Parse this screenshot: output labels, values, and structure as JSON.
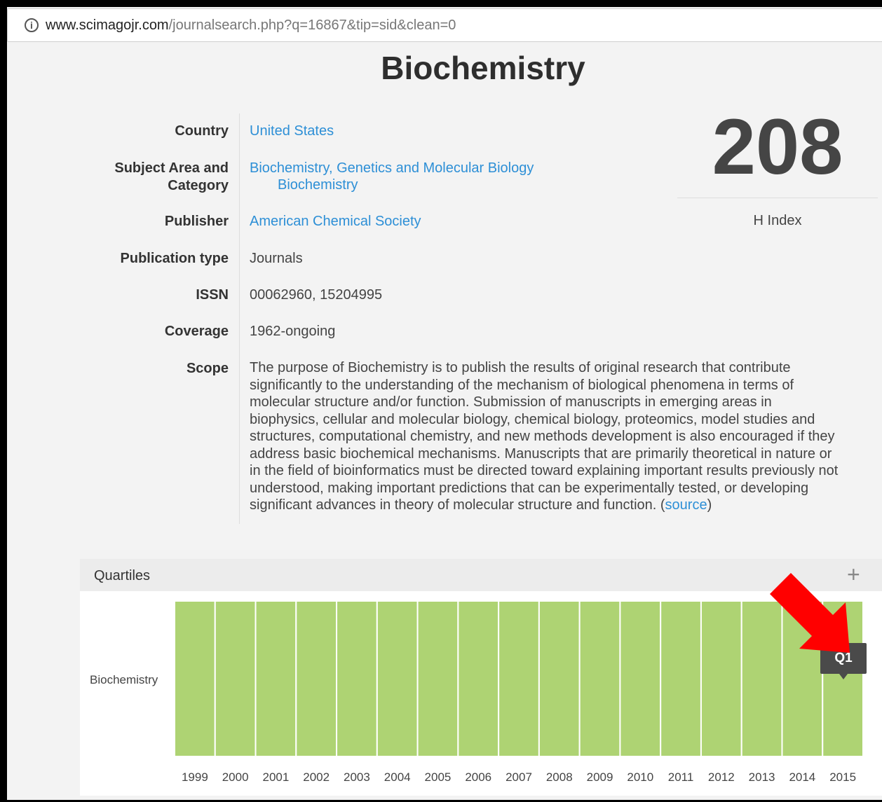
{
  "browser": {
    "url_host": "www.scimagojr.com",
    "url_path": "/journalsearch.php?q=16867&tip=sid&clean=0"
  },
  "journal": {
    "title": "Biochemistry",
    "fields": {
      "country_label": "Country",
      "country_value": "United States",
      "subject_label_1": "Subject Area and",
      "subject_label_2": "Category",
      "subject_area": "Biochemistry, Genetics and Molecular Biology",
      "subject_category": "Biochemistry",
      "publisher_label": "Publisher",
      "publisher_value": "American Chemical Society",
      "pubtype_label": "Publication type",
      "pubtype_value": "Journals",
      "issn_label": "ISSN",
      "issn_value": "00062960, 15204995",
      "coverage_label": "Coverage",
      "coverage_value": "1962-ongoing",
      "scope_label": "Scope",
      "scope_lines": [
        "The purpose of Biochemistry is to publish the results of original research that contribute",
        "significantly to the understanding of the mechanism of biological phenomena in terms of",
        "molecular structure and/or function. Submission of manuscripts in emerging areas in",
        "biophysics, cellular and molecular biology, chemical biology, proteomics, model studies and",
        "structures, computational chemistry, and new methods development is also encouraged if they",
        "address basic biochemical mechanisms. Manuscripts that are primarily theoretical in nature or",
        "in the field of bioinformatics must be directed toward explaining important results previously not",
        "understood, making important predictions that can be experimentally tested, or developing"
      ],
      "scope_last_line": "significant advances in theory of molecular structure and function. (",
      "scope_source_link": "source",
      "scope_close": ")"
    },
    "h_index": {
      "value": "208",
      "label": "H Index"
    }
  },
  "quartiles_panel": {
    "title": "Quartiles",
    "expand_icon": "plus-icon",
    "tooltip": "Q1",
    "annotation_color": "#ff0000"
  },
  "chart_data": {
    "type": "heatmap",
    "rows": [
      "Biochemistry"
    ],
    "categories": [
      "1999",
      "2000",
      "2001",
      "2002",
      "2003",
      "2004",
      "2005",
      "2006",
      "2007",
      "2008",
      "2009",
      "2010",
      "2011",
      "2012",
      "2013",
      "2014",
      "2015"
    ],
    "series": [
      {
        "name": "Biochemistry",
        "values": [
          "Q1",
          "Q1",
          "Q1",
          "Q1",
          "Q1",
          "Q1",
          "Q1",
          "Q1",
          "Q1",
          "Q1",
          "Q1",
          "Q1",
          "Q1",
          "Q1",
          "Q1",
          "Q1",
          "Q1"
        ]
      }
    ],
    "colors": {
      "Q1": "#aed373"
    }
  }
}
